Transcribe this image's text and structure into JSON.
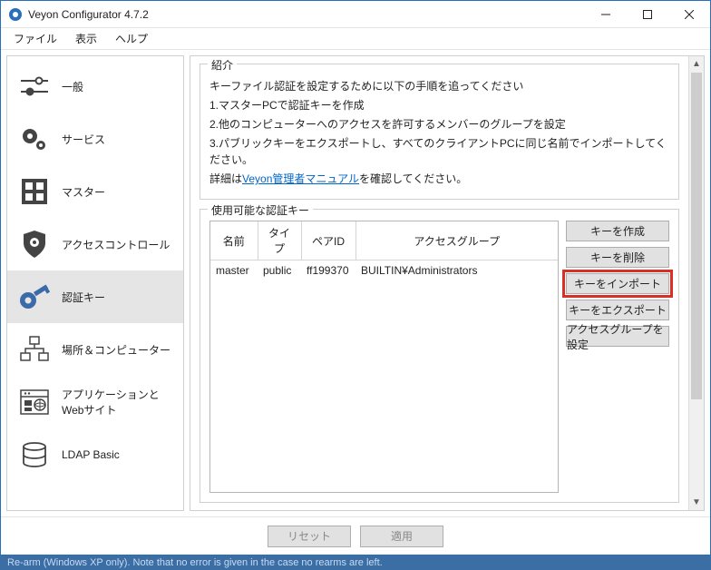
{
  "window": {
    "title": "Veyon Configurator 4.7.2"
  },
  "menubar": {
    "file": "ファイル",
    "view": "表示",
    "help": "ヘルプ"
  },
  "sidebar": {
    "items": [
      {
        "label": "一般"
      },
      {
        "label": "サービス"
      },
      {
        "label": "マスター"
      },
      {
        "label": "アクセスコントロール"
      },
      {
        "label": "認証キー"
      },
      {
        "label": "場所＆コンピューター"
      },
      {
        "label": "アプリケーションとWebサイト"
      },
      {
        "label": "LDAP Basic"
      }
    ]
  },
  "intro": {
    "legend": "紹介",
    "line1": "キーファイル認証を設定するために以下の手順を追ってください",
    "line2": "1.マスターPCで認証キーを作成",
    "line3": "2.他のコンピューターへのアクセスを許可するメンバーのグループを設定",
    "line4": "3.パブリックキーをエクスポートし、すべてのクライアントPCに同じ名前でインポートしてください。",
    "line5a": "詳細は",
    "line5link": "Veyon管理者マニュアル",
    "line5b": "を確認してください。"
  },
  "keys": {
    "legend": "使用可能な認証キー",
    "headers": {
      "name": "名前",
      "type": "タイプ",
      "pairid": "ペアID",
      "group": "アクセスグループ"
    },
    "rows": [
      {
        "name": "master",
        "type": "public",
        "pairid": "ff199370",
        "group": "BUILTIN¥Administrators"
      }
    ],
    "buttons": {
      "create": "キーを作成",
      "delete": "キーを削除",
      "import": "キーをインポート",
      "export": "キーをエクスポート",
      "setgroup": "アクセスグループを設定"
    }
  },
  "bottombar": {
    "reset": "リセット",
    "apply": "適用"
  },
  "footer": {
    "note": "Re-arm (Windows XP only). Note that no error is given in the case no rearms are left."
  }
}
